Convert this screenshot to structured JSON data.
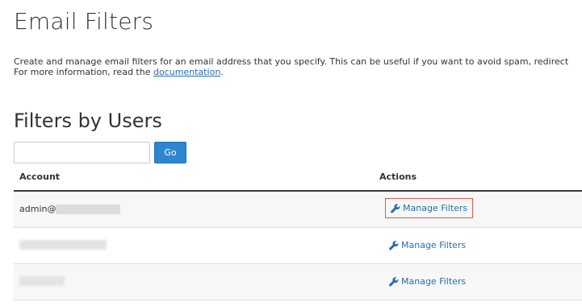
{
  "header": {
    "title": "Email Filters",
    "description_line1": "Create and manage email filters for an email address that you specify. This can be useful if you want to avoid spam, redirect",
    "description_line2_prefix": "For more information, read the ",
    "documentation_link": "documentation",
    "description_line2_suffix": "."
  },
  "filters": {
    "section_title": "Filters by Users",
    "search": {
      "value": "",
      "placeholder": ""
    },
    "go_label": "Go",
    "columns": {
      "account": "Account",
      "actions": "Actions"
    },
    "rows": [
      {
        "account_prefix": "admin@",
        "action_label": "Manage Filters",
        "highlighted": true
      },
      {
        "account_prefix": "",
        "action_label": "Manage Filters",
        "highlighted": false
      },
      {
        "account_prefix": "",
        "action_label": "Manage Filters",
        "highlighted": false
      }
    ]
  },
  "colors": {
    "link": "#2a6db0",
    "go_button": "#2f86d0",
    "highlight_border": "#e05555",
    "row_stripe": "#f7f7f7"
  },
  "icons": {
    "action": "wrench-icon"
  }
}
